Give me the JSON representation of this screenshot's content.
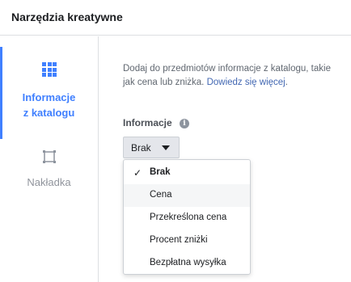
{
  "header": {
    "title": "Narzędzia kreatywne"
  },
  "nav": {
    "active_label": "Informacje\nz katalogu",
    "active_icon": "grid-icon",
    "overlay_label": "Nakładka",
    "overlay_icon": "frame-icon",
    "accent_color": "#4080ff"
  },
  "content": {
    "description": "Dodaj do przedmiotów informacje z katalogu, takie jak cena lub zniżka.",
    "learn_more": "Dowiedz się więcej",
    "learn_more_suffix": ".",
    "field_label": "Informacje",
    "info_icon": "info-icon",
    "dropdown_value": "Brak",
    "menu_items": [
      {
        "label": "Brak",
        "selected": true
      },
      {
        "label": "Cena",
        "hover": true
      },
      {
        "label": "Przekreślona cena"
      },
      {
        "label": "Procent zniżki"
      },
      {
        "label": "Bezpłatna wysyłka"
      }
    ]
  }
}
